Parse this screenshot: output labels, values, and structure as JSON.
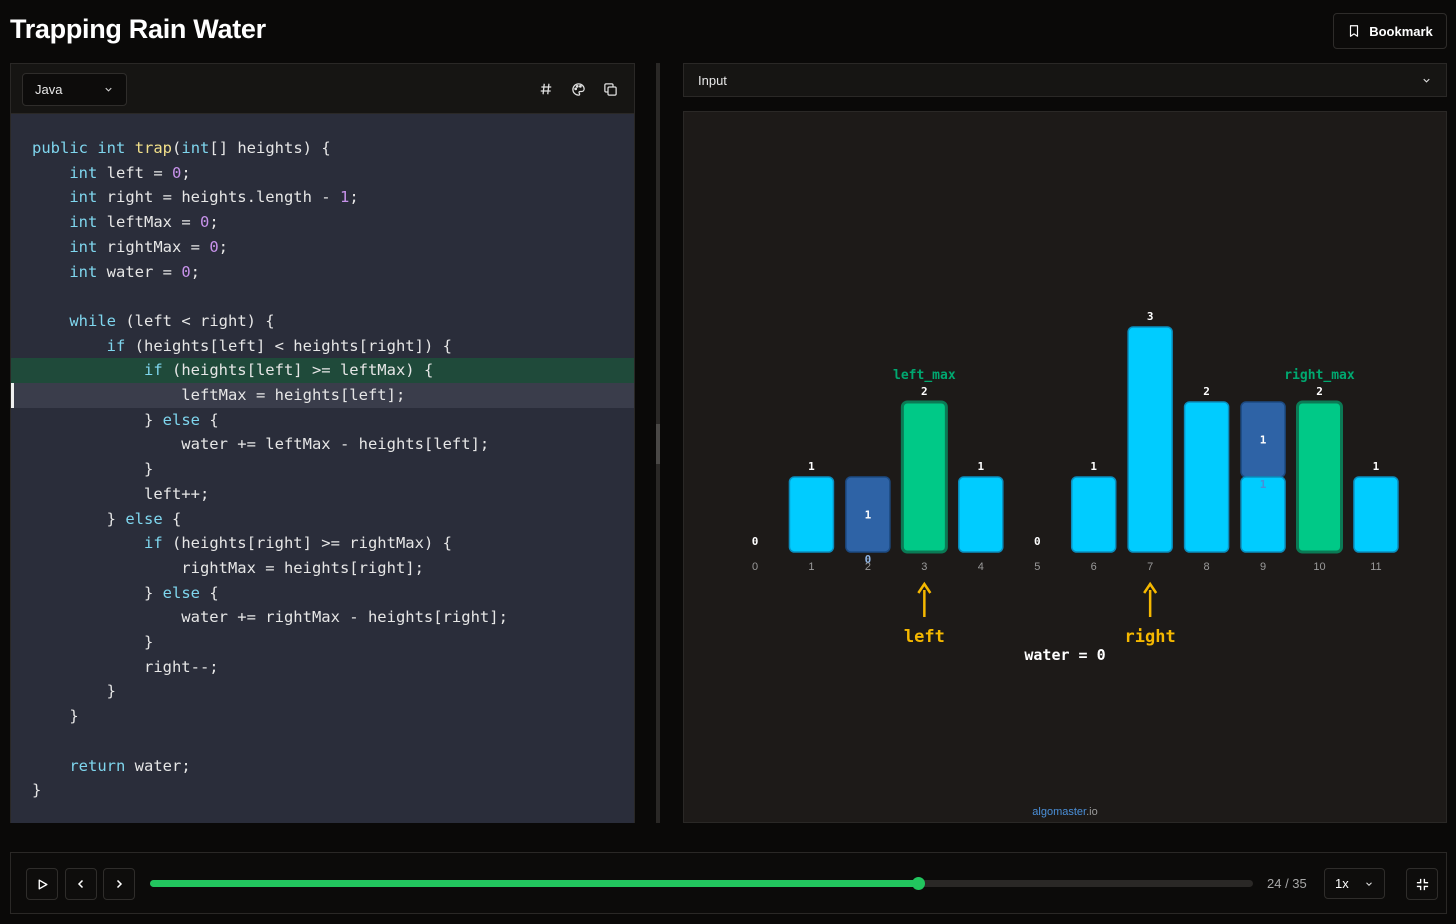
{
  "page": {
    "title": "Trapping Rain Water",
    "bookmark_label": "Bookmark"
  },
  "code_panel": {
    "language": "Java",
    "icons": [
      "hash-icon",
      "palette-icon",
      "copy-icon"
    ],
    "highlighted_line": 9,
    "cursor_line": 10,
    "lines": [
      "public int trap(int[] heights) {",
      "    int left = 0;",
      "    int right = heights.length - 1;",
      "    int leftMax = 0;",
      "    int rightMax = 0;",
      "    int water = 0;",
      "",
      "    while (left < right) {",
      "        if (heights[left] < heights[right]) {",
      "            if (heights[left] >= leftMax) {",
      "                leftMax = heights[left];",
      "            } else {",
      "                water += leftMax - heights[left];",
      "            }",
      "            left++;",
      "        } else {",
      "            if (heights[right] >= rightMax) {",
      "                rightMax = heights[right];",
      "            } else {",
      "                water += rightMax - heights[right];",
      "            }",
      "            right--;",
      "        }",
      "    }",
      "",
      "    return water;",
      "}"
    ]
  },
  "input_panel": {
    "label": "Input"
  },
  "chart_data": {
    "type": "bar",
    "categories": [
      "0",
      "1",
      "2",
      "3",
      "4",
      "5",
      "6",
      "7",
      "8",
      "9",
      "10",
      "11"
    ],
    "heights": [
      0,
      1,
      0,
      2,
      1,
      0,
      1,
      3,
      2,
      1,
      2,
      1
    ],
    "trapped_water": [
      0,
      0,
      1,
      0,
      0,
      0,
      0,
      0,
      0,
      1,
      0,
      0
    ],
    "water_labels": [
      "",
      "",
      "1",
      "",
      "",
      "",
      "",
      "",
      "",
      "1",
      "",
      ""
    ],
    "highlighted": {
      "3": "left_max",
      "10": "right_max"
    },
    "pointers": [
      {
        "index": 3,
        "label": "left"
      },
      {
        "index": 7,
        "label": "right"
      }
    ],
    "water_label": "water = 0",
    "colors": {
      "bar": "#00ccff",
      "max_bar": "#00c987",
      "water": "#2e63a6",
      "pointer": "#f5b800",
      "max_label": "#00a870"
    }
  },
  "watermark": {
    "part1": "algo",
    "part2": "master",
    "part3": ".io"
  },
  "player": {
    "progress": 0.6964,
    "step_text": "24 / 35",
    "speed": "1x"
  },
  "theme": {
    "accent": "#22c55e"
  }
}
